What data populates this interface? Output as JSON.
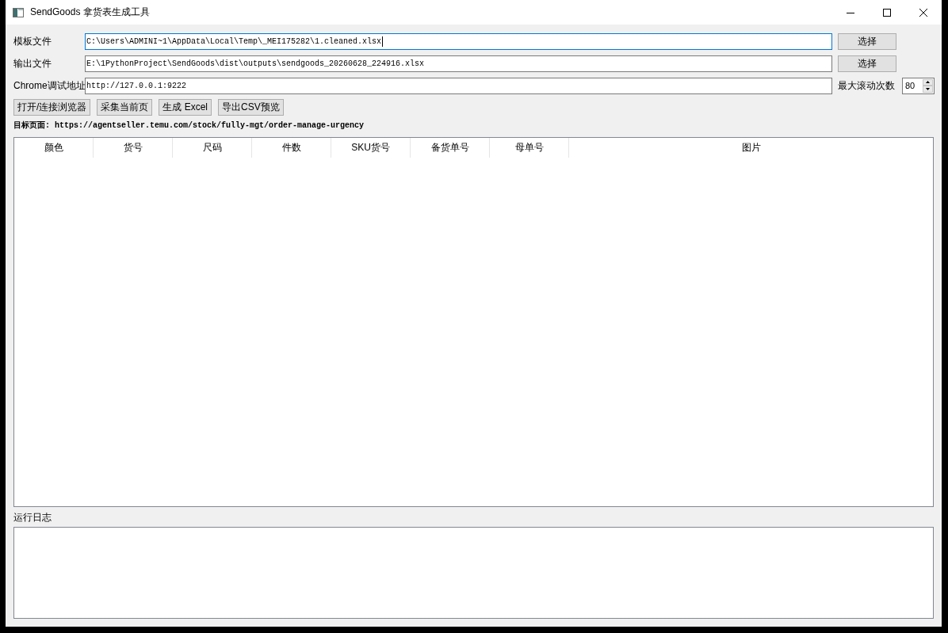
{
  "window": {
    "title": "SendGoods 拿货表生成工具"
  },
  "settings": [
    {
      "kind": "file",
      "label": "模板文件",
      "value": "C:\\Users\\ADMINI~1\\AppData\\Local\\Temp\\_MEI175282\\1.cleaned.xlsx",
      "focused": true,
      "button": "选择"
    },
    {
      "kind": "file",
      "label": "输出文件",
      "value": "E:\\1PythonProject\\SendGoods\\dist\\outputs\\sendgoods_20260628_224916.xlsx",
      "focused": false,
      "button": "选择"
    },
    {
      "kind": "address",
      "label": "Chrome调试地址",
      "value": "http://127.0.0.1:9222",
      "focused": false,
      "spin_label": "最大滚动次数",
      "spin_value": "80"
    }
  ],
  "actions": [
    "打开/连接浏览器",
    "采集当前页",
    "生成 Excel",
    "导出CSV预览"
  ],
  "target_page": "目标页面: https://agentseller.temu.com/stock/fully-mgt/order-manage-urgency",
  "table": {
    "columns": [
      "颜色",
      "货号",
      "尺码",
      "件数",
      "SKU货号",
      "备货单号",
      "母单号",
      "图片"
    ]
  },
  "log": {
    "label": "运行日志"
  }
}
